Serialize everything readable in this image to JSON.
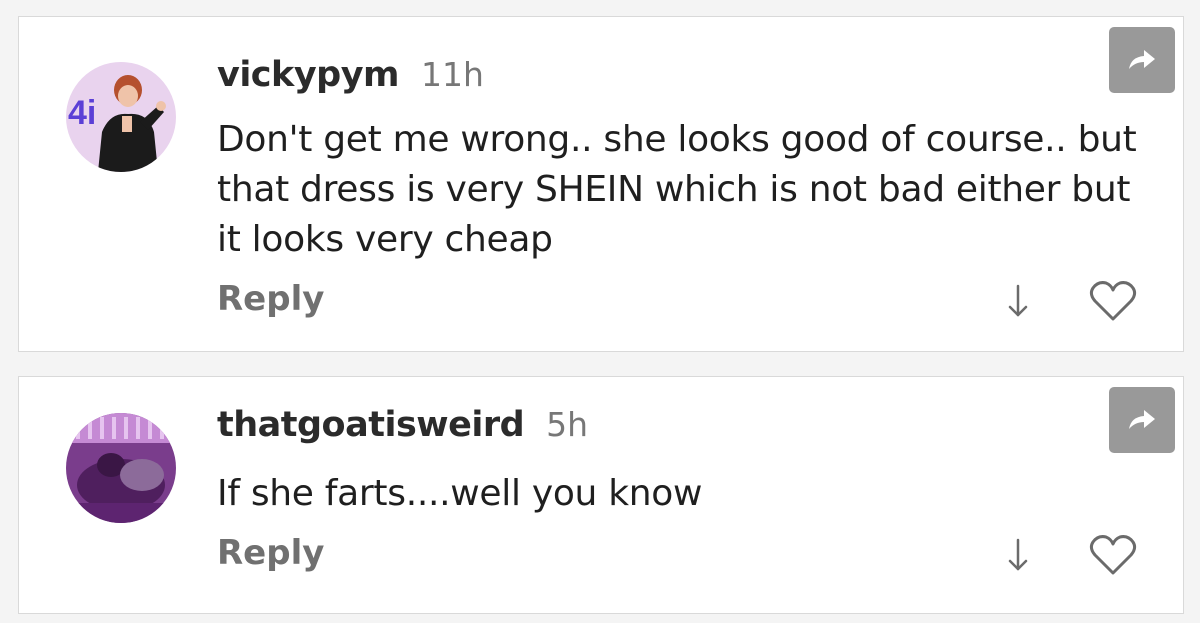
{
  "comments": [
    {
      "username": "vickypym",
      "timestamp": "11h",
      "text": "Don't get me wrong.. she looks good of course.. but that dress is very SHEIN which is not bad either but it looks very cheap",
      "reply_label": "Reply",
      "avatar_sign_text": "4i",
      "avatar_icon": "profile-photo",
      "share_icon": "share-arrow-icon",
      "sort_icon": "arrow-down-icon",
      "like_icon": "heart-outline-icon"
    },
    {
      "username": "thatgoatisweird",
      "timestamp": "5h",
      "text": "If she farts....well you know",
      "reply_label": "Reply",
      "avatar_icon": "profile-photo",
      "share_icon": "share-arrow-icon",
      "sort_icon": "arrow-down-icon",
      "like_icon": "heart-outline-icon"
    }
  ],
  "colors": {
    "username": "#2b2b2b",
    "timestamp": "#777777",
    "text": "#1f1f1f",
    "reply": "#707070",
    "share_button_bg": "#999999",
    "card_border": "#d9d9d9",
    "page_bg": "#f4f4f4"
  }
}
